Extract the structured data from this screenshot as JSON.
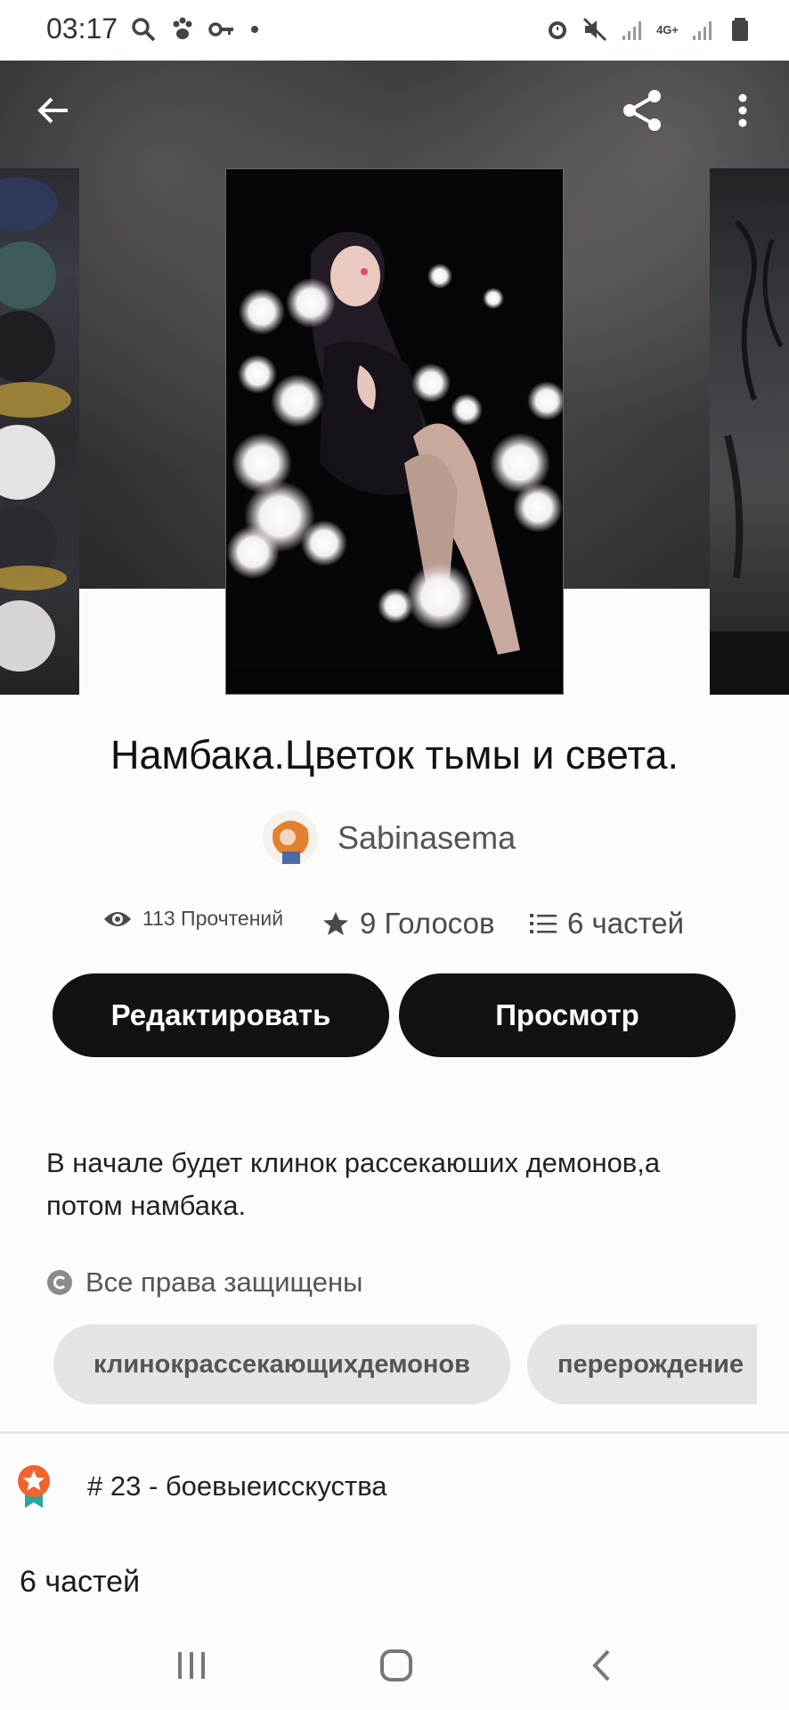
{
  "status_bar": {
    "time": "03:17",
    "left_icons": [
      "search-icon",
      "paw-icon",
      "key-icon",
      "dot-icon"
    ],
    "right_icons": [
      "alarm-icon",
      "mute-icon",
      "signal-icon",
      "4g-icon",
      "signal-icon",
      "battery-icon"
    ],
    "network_label": "4G+"
  },
  "header": {
    "back_icon": "arrow-left-icon",
    "share_icon": "share-icon",
    "more_icon": "more-vertical-icon"
  },
  "story": {
    "title": "Намбака.Цветок тьмы и света.",
    "author": "Sabinasema",
    "stats": {
      "reads": "113 Прочтений",
      "votes": "9 Голосов",
      "parts": "6 частей"
    },
    "buttons": {
      "edit": "Редактировать",
      "view": "Просмотр"
    },
    "description": "В начале будет клинок рассекаюших демонов,а потом намбака.",
    "rights": "Все права защищены",
    "tags": [
      "клинокрассекающихдемонов",
      "перерождение"
    ],
    "rank": "# 23 - боевыеисскуства",
    "parts_heading": "6 частей"
  },
  "colors": {
    "button_bg": "#121212",
    "tag_bg": "#e4e3e5",
    "rank_badge": "#f0642d"
  },
  "nav_bar": {
    "icons": [
      "recent-apps-icon",
      "home-icon",
      "back-icon"
    ]
  }
}
